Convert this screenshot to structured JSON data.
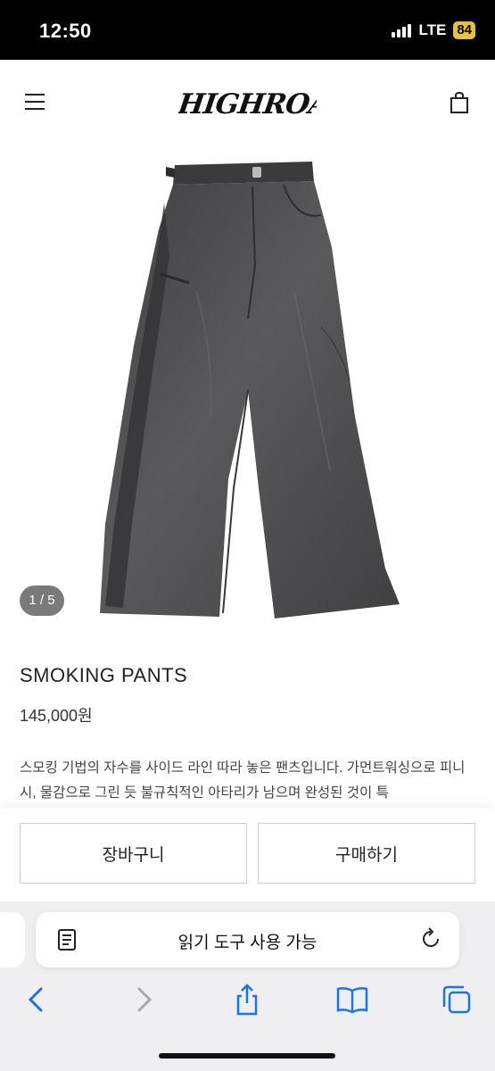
{
  "status_bar": {
    "time": "12:50",
    "network": "LTE",
    "battery": "84"
  },
  "header": {
    "logo": "HIGHROAD",
    "menu_icon": "hamburger-menu-icon",
    "cart_icon": "shopping-bag-icon"
  },
  "product": {
    "image_counter": "1 / 5",
    "title": "SMOKING PANTS",
    "price": "145,000원",
    "description": "스모킹 기법의 자수를 사이드 라인 따라 놓은 팬츠입니다. 가먼트워싱으로 피니시, 물감으로 그린 듯 불규칙적인 아타리가 남으며 완성된 것이 특",
    "image_colors": {
      "fabric": "#4d4d4f",
      "fabric_dark": "#3a3a3c"
    }
  },
  "actions": {
    "add_to_cart": "장바구니",
    "buy_now": "구매하기"
  },
  "browser": {
    "address_text": "읽기 도구 사용 가능",
    "toolbar": [
      "back-icon",
      "forward-icon",
      "share-icon",
      "bookmarks-icon",
      "tabs-icon"
    ],
    "accent_color": "#1a73e8"
  }
}
